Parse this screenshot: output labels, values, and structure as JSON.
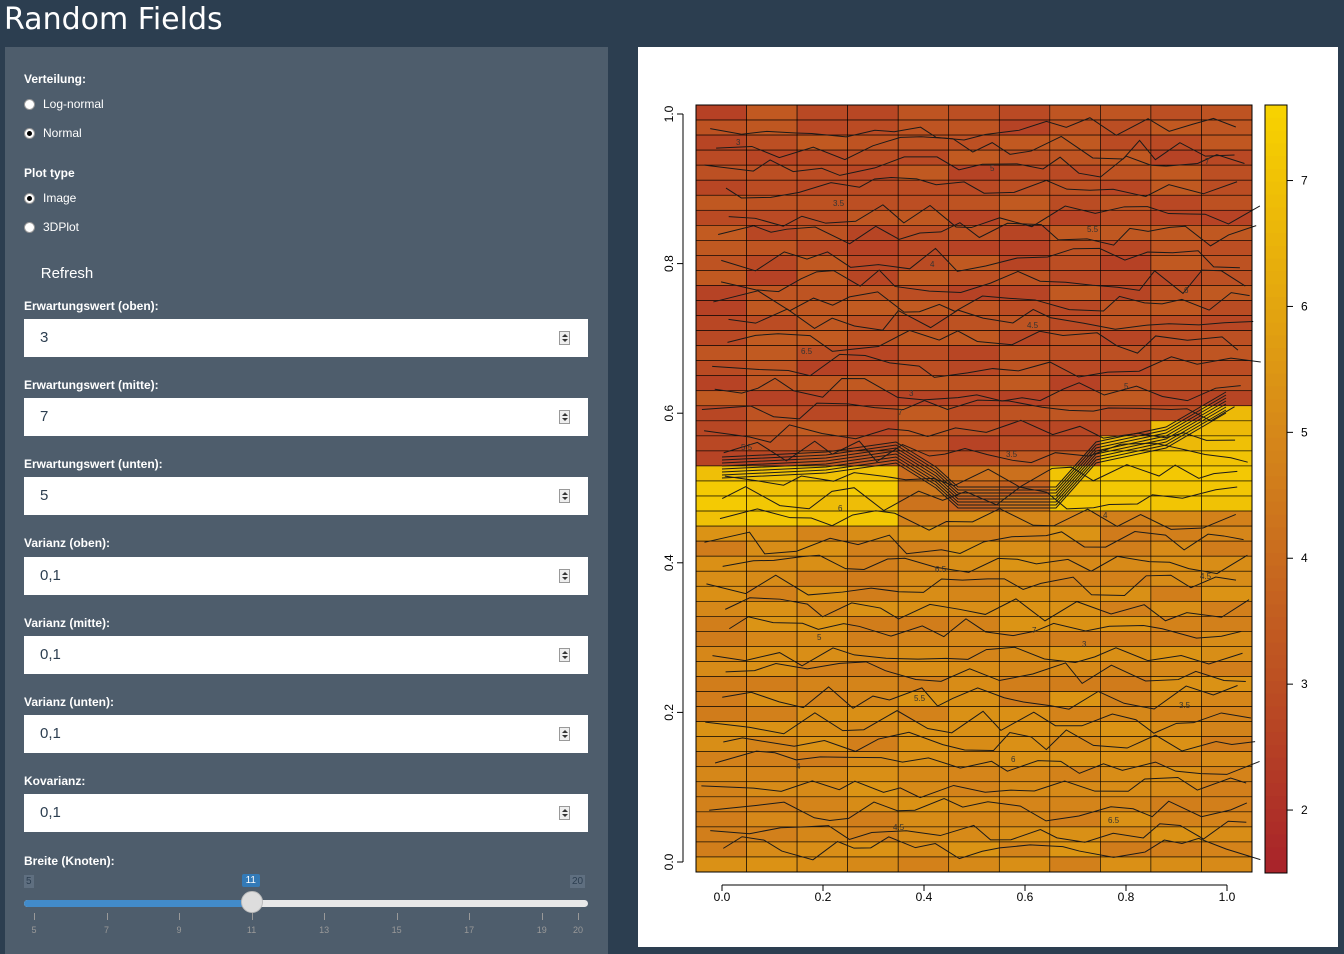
{
  "app": {
    "title": "Random Fields"
  },
  "sidebar": {
    "distribution": {
      "label": "Verteilung:",
      "options": [
        "Log-normal",
        "Normal"
      ],
      "selected": "Normal"
    },
    "plot_type": {
      "label": "Plot type",
      "options": [
        "Image",
        "3DPlot"
      ],
      "selected": "Image"
    },
    "refresh_label": "Refresh",
    "inputs": [
      {
        "label": "Erwartungswert (oben):",
        "value": "3"
      },
      {
        "label": "Erwartungswert (mitte):",
        "value": "7"
      },
      {
        "label": "Erwartungswert (unten):",
        "value": "5"
      },
      {
        "label": "Varianz (oben):",
        "value": "0,1"
      },
      {
        "label": "Varianz (mitte):",
        "value": "0,1"
      },
      {
        "label": "Varianz (unten):",
        "value": "0,1"
      },
      {
        "label": "Kovarianz:",
        "value": "0,1"
      }
    ],
    "slider": {
      "label": "Breite (Knoten):",
      "min": 5,
      "max": 20,
      "value": 11,
      "ticks": [
        5,
        7,
        9,
        11,
        13,
        15,
        17,
        19,
        20
      ]
    }
  },
  "chart_data": {
    "type": "heatmap",
    "title": "",
    "xlabel": "",
    "ylabel": "",
    "xlim": [
      0,
      1
    ],
    "ylim": [
      0,
      1
    ],
    "x_ticks": [
      "0.0",
      "0.2",
      "0.4",
      "0.6",
      "0.8",
      "1.0"
    ],
    "y_ticks": [
      "0.0",
      "0.2",
      "0.4",
      "0.6",
      "0.8",
      "1.0"
    ],
    "colorbar_ticks": [
      "2",
      "3",
      "4",
      "5",
      "6",
      "7"
    ],
    "colorbar_range": [
      1.5,
      7.6
    ],
    "grid_columns": 11,
    "grid_rows": 51,
    "color_low": "#a8232a",
    "color_mid": "#d4841a",
    "color_high": "#f8d300",
    "regions": [
      {
        "name": "oben",
        "y_from": 0.54,
        "y_to": 1.0,
        "value": 3
      },
      {
        "name": "mitte",
        "y_from": 0.44,
        "y_to": 0.62,
        "value": 7
      },
      {
        "name": "unten",
        "y_from": 0.0,
        "y_to": 0.48,
        "value": 5
      }
    ],
    "contour_labels": [
      "3",
      "3.5",
      "4",
      "4.5",
      "5",
      "5.5",
      "6",
      "6.5",
      "7"
    ]
  }
}
